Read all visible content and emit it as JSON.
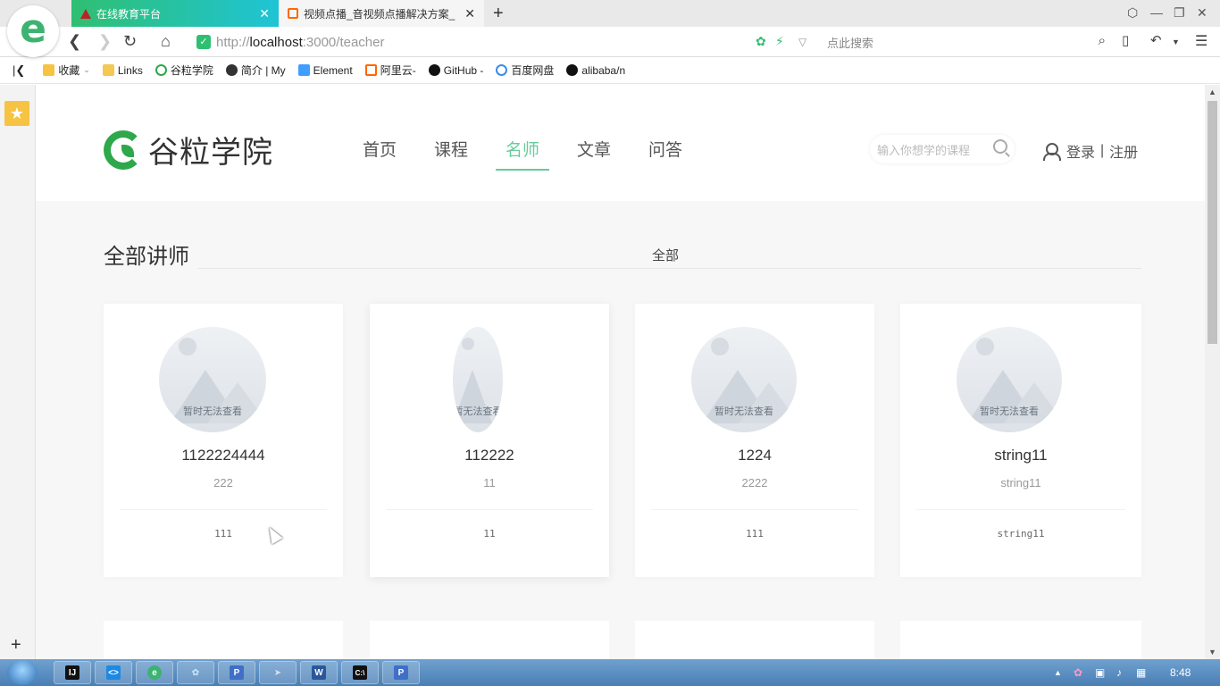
{
  "browser": {
    "tabs": [
      {
        "label": "在线教育平台",
        "active": true
      },
      {
        "label": "视频点播_音视频点播解决方案_",
        "active": false
      }
    ],
    "url_prefix": "http://",
    "url_host": "localhost",
    "url_rest": ":3000/teacher",
    "search_placeholder": "点此搜索",
    "bookmarks": [
      "收藏",
      "Links",
      "谷粒学院",
      "简介 | My",
      "Element",
      "阿里云-",
      "GitHub -",
      "百度网盘",
      "alibaba/n"
    ]
  },
  "site": {
    "logo_text": "谷粒学院",
    "nav": [
      "首页",
      "课程",
      "名师",
      "文章",
      "问答"
    ],
    "active_nav": "名师",
    "search_placeholder": "输入你想学的课程",
    "login": "登录",
    "separator": "|",
    "register": "注册"
  },
  "section": {
    "title": "全部讲师",
    "filter": "全部"
  },
  "teachers": [
    {
      "name": "1122224444",
      "intro": "222",
      "career": "111",
      "avatar_text": "暂时无法查看"
    },
    {
      "name": "112222",
      "intro": "11",
      "career": "11",
      "avatar_text": "暂无法查看"
    },
    {
      "name": "1224",
      "intro": "2222",
      "career": "111",
      "avatar_text": "暂时无法查看"
    },
    {
      "name": "string11",
      "intro": "string11",
      "career": "string11",
      "avatar_text": "暂时无法查看"
    }
  ],
  "taskbar": {
    "clock": "8:48"
  },
  "colors": {
    "brand_green": "#2ea84a",
    "nav_active": "#68cb9b",
    "tab_gradient_start": "#2fbf71",
    "tab_gradient_end": "#1fc4d6"
  }
}
